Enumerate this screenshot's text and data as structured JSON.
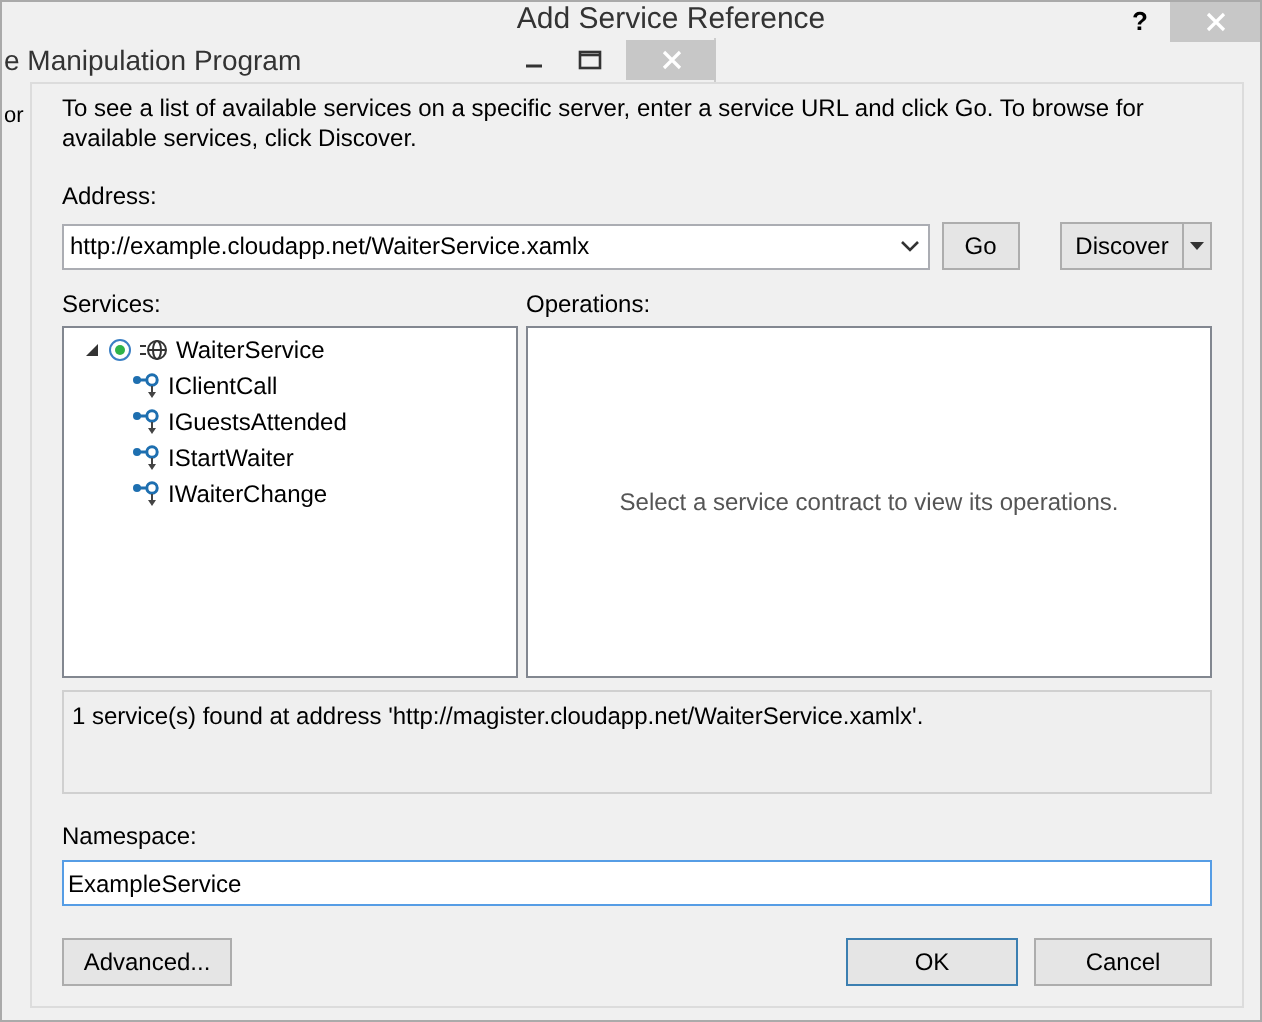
{
  "window": {
    "title": "Add Service Reference",
    "help": "?"
  },
  "background_window": {
    "title": "e Manipulation Program",
    "side_text": "or"
  },
  "intro": "To see a list of available services on a specific server, enter a service URL and click Go. To browse for available services, click Discover.",
  "address": {
    "label": "Address:",
    "value": "http://example.cloudapp.net/WaiterService.xamlx",
    "go": "Go",
    "discover": "Discover"
  },
  "services": {
    "label": "Services:",
    "tree": [
      {
        "label": "WaiterService",
        "expanded": true,
        "children": [
          {
            "label": "IClientCall"
          },
          {
            "label": "IGuestsAttended"
          },
          {
            "label": "IStartWaiter"
          },
          {
            "label": "IWaiterChange"
          }
        ]
      }
    ]
  },
  "operations": {
    "label": "Operations:",
    "placeholder_text": "Select a service contract to view its operations."
  },
  "status": "1 service(s) found at address 'http://magister.cloudapp.net/WaiterService.xamlx'.",
  "namespace": {
    "label": "Namespace:",
    "value": "ExampleService"
  },
  "buttons": {
    "advanced": "Advanced...",
    "ok": "OK",
    "cancel": "Cancel"
  }
}
